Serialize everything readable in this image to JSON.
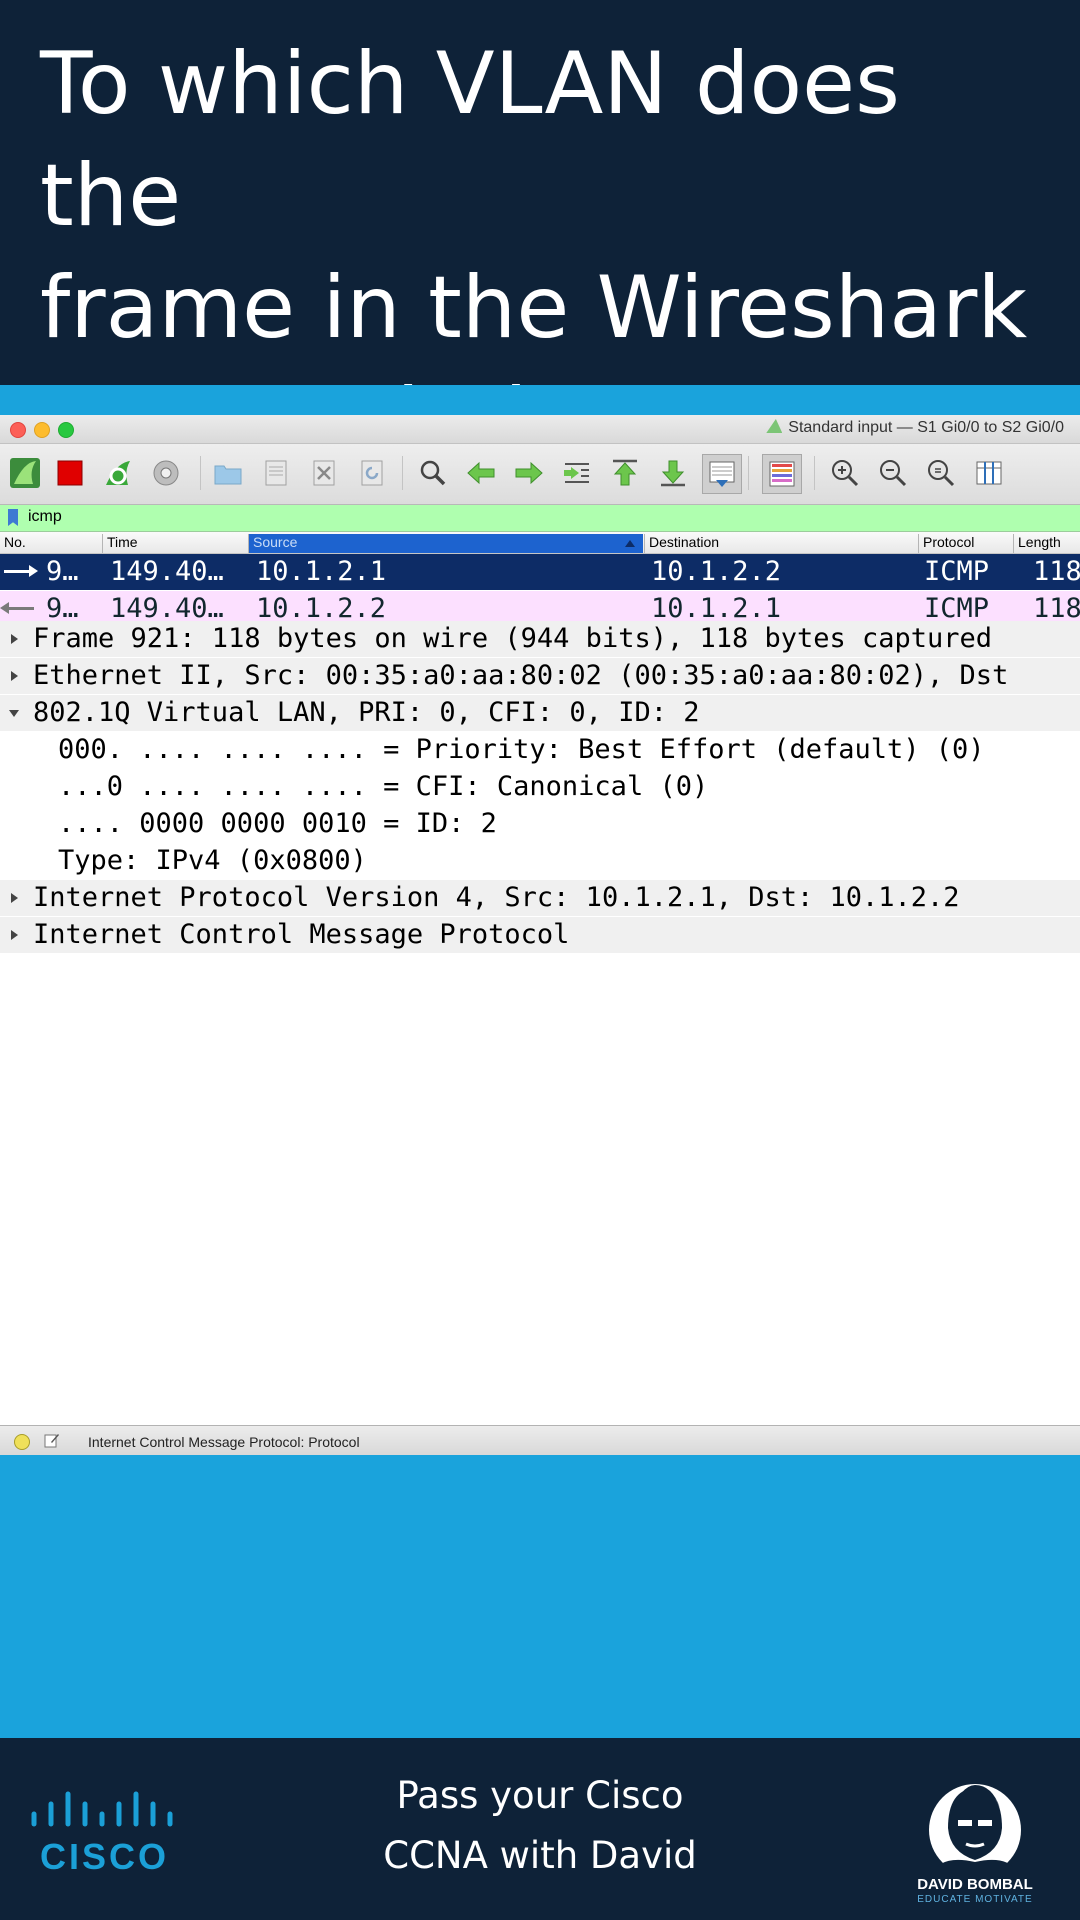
{
  "question": {
    "line1": "To which VLAN does the",
    "line2": "frame in the Wireshark",
    "line3": "capture belong?"
  },
  "window": {
    "title": "Standard input — S1 Gi0/0 to S2 Gi0/0"
  },
  "toolbar": {
    "icons": [
      "shark-fin-start-icon",
      "stop-capture-icon",
      "restart-capture-icon",
      "capture-options-icon",
      "open-file-icon",
      "save-file-icon",
      "close-file-icon",
      "reload-icon",
      "find-packet-icon",
      "go-back-icon",
      "go-forward-icon",
      "go-to-packet-icon",
      "first-packet-icon",
      "last-packet-icon",
      "autoscroll-icon",
      "colorize-icon",
      "zoom-in-icon",
      "zoom-out-icon",
      "normal-size-icon",
      "resize-columns-icon"
    ]
  },
  "filter": {
    "value": "icmp",
    "bar_color": "#afffaf"
  },
  "columns": [
    "No.",
    "Time",
    "Source",
    "Destination",
    "Protocol",
    "Length"
  ],
  "sorted_column": "Source",
  "packets": [
    {
      "no": "9…",
      "time": "149.40…",
      "source": "10.1.2.1",
      "destination": "10.1.2.2",
      "protocol": "ICMP",
      "length": "118",
      "direction": "request",
      "selected": true
    },
    {
      "no": "9…",
      "time": "149.40…",
      "source": "10.1.2.2",
      "destination": "10.1.2.1",
      "protocol": "ICMP",
      "length": "118",
      "direction": "reply",
      "selected": false
    }
  ],
  "details": [
    {
      "text": "Frame 921: 118 bytes on wire (944 bits), 118 bytes captured",
      "expanded": false,
      "level": 0
    },
    {
      "text": "Ethernet II, Src: 00:35:a0:aa:80:02 (00:35:a0:aa:80:02), Dst",
      "expanded": false,
      "level": 0
    },
    {
      "text": "802.1Q Virtual LAN, PRI: 0, CFI: 0, ID: 2",
      "expanded": true,
      "level": 0
    },
    {
      "text": "000. .... .... .... = Priority: Best Effort (default) (0)",
      "level": 1
    },
    {
      "text": "...0 .... .... .... = CFI: Canonical (0)",
      "level": 1
    },
    {
      "text": ".... 0000 0000 0010 = ID: 2",
      "level": 1
    },
    {
      "text": "Type: IPv4 (0x0800)",
      "level": 1
    },
    {
      "text": "Internet Protocol Version 4, Src: 10.1.2.1, Dst: 10.1.2.2",
      "expanded": false,
      "level": 0
    },
    {
      "text": "Internet Control Message Protocol",
      "expanded": false,
      "level": 0
    }
  ],
  "status": {
    "text": "Internet Control Message Protocol: Protocol"
  },
  "footer": {
    "line1": "Pass your Cisco",
    "line2": "CCNA with David",
    "cisco_logo_text": "CISCO",
    "brand_name": "DAVID BOMBAL",
    "brand_motto": "EDUCATE MOTIVATE"
  },
  "colors": {
    "header_bg": "#0e2238",
    "page_bg": "#1aa3dc",
    "selected_row": "#0d2c66",
    "reply_row": "#fce0ff",
    "cisco_blue": "#1ba0d7"
  }
}
